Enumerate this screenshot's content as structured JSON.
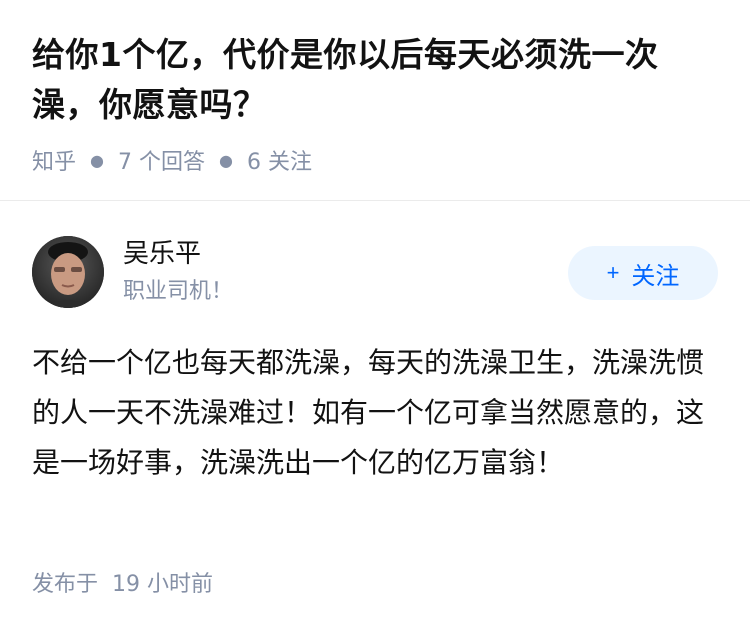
{
  "question": {
    "title": "给你1个亿，代价是你以后每天必须洗一次澡，你愿意吗？",
    "source": "知乎",
    "answer_count": "7 个回答",
    "follower_count": "6 关注"
  },
  "author": {
    "name": "吴乐平",
    "bio": "职业司机！",
    "follow_label": "关注",
    "avatar_icon": "avatar-photo"
  },
  "answer": {
    "text": "不给一个亿也每天都洗澡，每天的洗澡卫生，洗澡洗惯的人一天不洗澡难过！如有一个亿可拿当然愿意的，这是一场好事，洗澡洗出一个亿的亿万富翁！",
    "published_label": "发布于",
    "published_time": "19 小时前"
  },
  "colors": {
    "accent": "#0066ff",
    "follow_bg": "#ebf5ff",
    "muted_text": "#8590a6",
    "primary_text": "#121212"
  }
}
